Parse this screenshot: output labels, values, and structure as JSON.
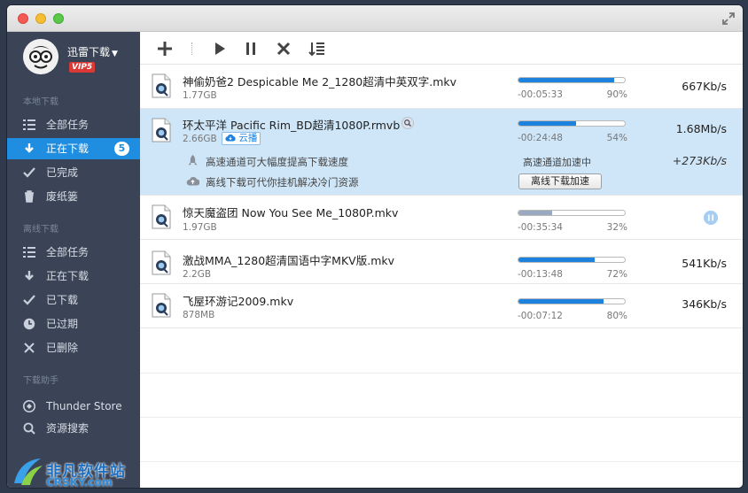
{
  "app": {
    "user_name": "迅雷下载",
    "vip": "VIP5"
  },
  "sidebar": {
    "local_title": "本地下载",
    "local_items": [
      {
        "label": "全部任务",
        "icon": "list-icon"
      },
      {
        "label": "正在下载",
        "icon": "download-arrow-icon",
        "badge": "5",
        "active": true
      },
      {
        "label": "已完成",
        "icon": "check-icon"
      },
      {
        "label": "废纸篓",
        "icon": "trash-icon"
      }
    ],
    "offline_title": "离线下载",
    "offline_items": [
      {
        "label": "全部任务",
        "icon": "list-icon"
      },
      {
        "label": "正在下载",
        "icon": "download-arrow-icon"
      },
      {
        "label": "已下载",
        "icon": "check-icon"
      },
      {
        "label": "已过期",
        "icon": "clock-icon"
      },
      {
        "label": "已删除",
        "icon": "x-icon"
      }
    ],
    "assist_title": "下载助手",
    "assist_items": [
      {
        "label": "Thunder Store",
        "icon": "store-icon"
      },
      {
        "label": "资源搜索",
        "icon": "search-icon"
      }
    ]
  },
  "watermark": {
    "cn": "非凡软件站",
    "en": "CRSKY.com"
  },
  "tasks": [
    {
      "name": "神偷奶爸2 Despicable Me 2_1280超清中英双字.mkv",
      "size": "1.77GB",
      "time": "-00:05:33",
      "percent": "90%",
      "progress": 0.9,
      "speed": "667Kb/s"
    },
    {
      "name": "环太平洋 Pacific Rim_BD超清1080P.rmvb",
      "size": "2.66GB",
      "cloud": "云播",
      "time": "-00:24:48",
      "percent": "54%",
      "progress": 0.54,
      "speed": "1.68Mb/s",
      "accel": {
        "line1": "高速通道可大幅度提高下载速度",
        "line2": "离线下载可代你挂机解决冷门资源",
        "status": "高速通道加速中",
        "extra_speed": "+273Kb/s",
        "button": "离线下载加速"
      }
    },
    {
      "name": "惊天魔盗团 Now You See Me_1080P.mkv",
      "size": "1.97GB",
      "time": "-00:35:34",
      "percent": "32%",
      "progress": 0.32,
      "speed": "",
      "paused": true
    },
    {
      "name": "激战MMA_1280超清国语中字MKV版.mkv",
      "size": "2.2GB",
      "time": "-00:13:48",
      "percent": "72%",
      "progress": 0.72,
      "speed": "541Kb/s"
    },
    {
      "name": "飞屋环游记2009.mkv",
      "size": "878MB",
      "time": "-00:07:12",
      "percent": "80%",
      "progress": 0.8,
      "speed": "346Kb/s"
    }
  ],
  "colors": {
    "accent": "#1f8de0",
    "sidebar_bg": "#3a4456",
    "selected_row": "#cfe6f8"
  }
}
